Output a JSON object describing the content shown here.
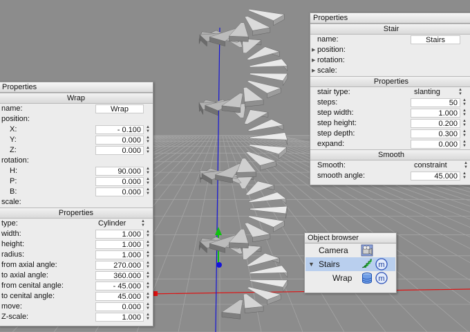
{
  "colors": {
    "viewport_bg": "#8c8c8c",
    "grid": "#a5a5a5",
    "axis_x": "#e01010",
    "axis_y": "#10c010",
    "axis_z": "#1414d8",
    "panel_bg": "#ececec",
    "selection": "#b9cfee"
  },
  "wrap_panel": {
    "title": "Properties",
    "header": "Wrap",
    "name_label": "name:",
    "name_value": "Wrap",
    "position_label": "position:",
    "x_label": "X:",
    "x_value": "-  0.100",
    "y_label": "Y:",
    "y_value": "0.000",
    "z_label": "Z:",
    "z_value": "0.000",
    "rotation_label": "rotation:",
    "h_label": "H:",
    "h_value": "90.000",
    "p_label": "P:",
    "p_value": "0.000",
    "b_label": "B:",
    "b_value": "0.000",
    "scale_label": "scale:",
    "props_header": "Properties",
    "type_label": "type:",
    "type_value": "Cylinder",
    "width_label": "width:",
    "width_value": "1.000",
    "height_label": "height:",
    "height_value": "1.000",
    "radius_label": "radius:",
    "radius_value": "1.000",
    "from_axial_label": "from axial angle:",
    "from_axial_value": "270.000",
    "to_axial_label": "to axial angle:",
    "to_axial_value": "360.000",
    "from_cenital_label": "from cenital angle:",
    "from_cenital_value": "-  45.000",
    "to_cenital_label": "to cenital angle:",
    "to_cenital_value": "45.000",
    "move_label": "move:",
    "move_value": "0.000",
    "zscale_label": "Z-scale:",
    "zscale_value": "1.000"
  },
  "stair_panel": {
    "title": "Properties",
    "header": "Stair",
    "name_label": "name:",
    "name_value": "Stairs",
    "position_label": "position:",
    "rotation_label": "rotation:",
    "scale_label": "scale:",
    "props_header": "Properties",
    "stair_type_label": "stair type:",
    "stair_type_value": "slanting",
    "steps_label": "steps:",
    "steps_value": "50",
    "step_width_label": "step width:",
    "step_width_value": "1.000",
    "step_height_label": "step height:",
    "step_height_value": "0.200",
    "step_depth_label": "step depth:",
    "step_depth_value": "0.300",
    "expand_label": "expand:",
    "expand_value": "0.000",
    "smooth_header": "Smooth",
    "smooth_label": "Smooth:",
    "smooth_value": "constraint",
    "smooth_angle_label": "smooth angle:",
    "smooth_angle_value": "45.000"
  },
  "object_browser": {
    "title": "Object browser",
    "camera_label": "Camera",
    "stairs_label": "Stairs",
    "wrap_label": "Wrap",
    "m_glyph": "m"
  }
}
